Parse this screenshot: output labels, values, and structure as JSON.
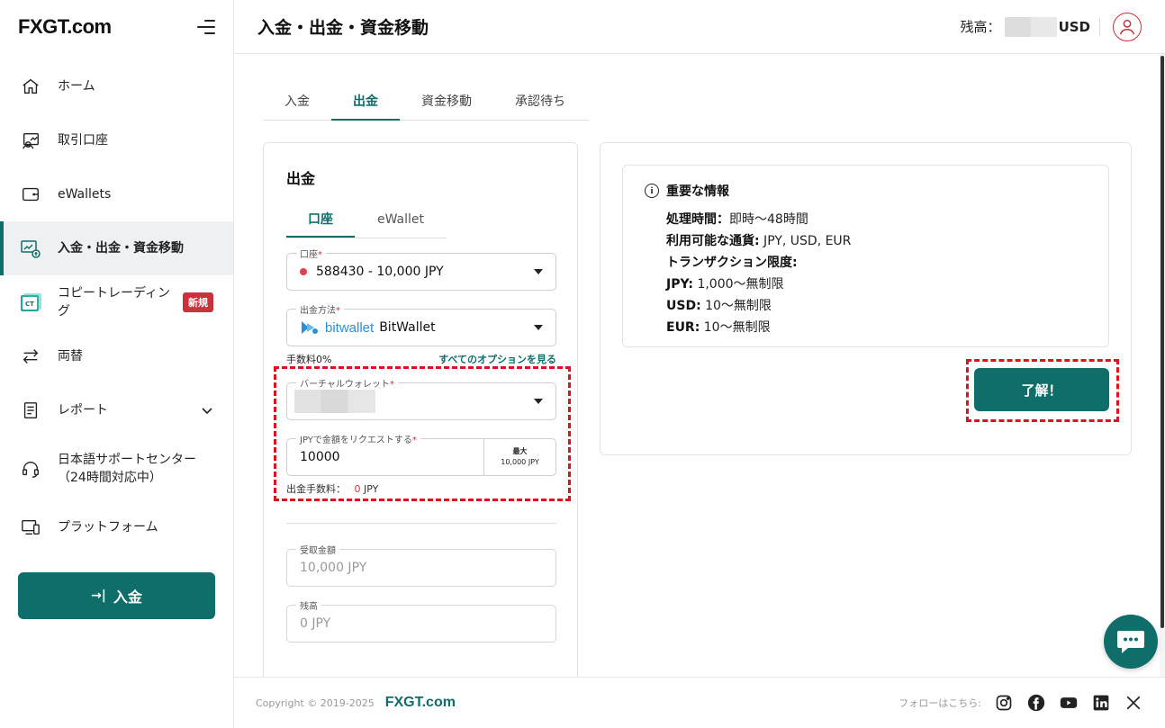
{
  "brand": {
    "logo": "FXGT.com",
    "accent": "#0f6e6a",
    "alert": "#c8323c"
  },
  "sidebar": {
    "items": [
      {
        "label": "ホーム",
        "icon": "home-icon"
      },
      {
        "label": "取引口座",
        "icon": "trading-account-icon"
      },
      {
        "label": "eWallets",
        "icon": "wallet-icon"
      },
      {
        "label": "入金・出金・資金移動",
        "icon": "funds-transfer-icon",
        "active": true
      },
      {
        "label": "コピートレーディング",
        "icon": "copy-trading-icon",
        "badge": "新規"
      },
      {
        "label": "両替",
        "icon": "exchange-icon"
      },
      {
        "label": "レポート",
        "icon": "report-icon"
      },
      {
        "label": "日本語サポートセンター（24時間対応中）",
        "icon": "support-headset-icon"
      },
      {
        "label": "プラットフォーム",
        "icon": "platform-icon"
      }
    ],
    "deposit_button": "入金"
  },
  "header": {
    "title": "入金・出金・資金移動",
    "balance_label": "残高：",
    "balance_currency": "USD"
  },
  "main": {
    "tabs": [
      "入金",
      "出金",
      "資金移動",
      "承認待ち"
    ],
    "active_tab": "出金",
    "withdraw": {
      "title": "出金",
      "subtabs": [
        "口座",
        "eWallet"
      ],
      "account": {
        "label": "口座",
        "value": "588430 - 10,000 JPY"
      },
      "method": {
        "label": "出金方法",
        "brand": "bitwallet",
        "value": "BitWallet"
      },
      "fee_text": "手数料0%",
      "see_all_options": "すべてのオプションを見る",
      "virtual_wallet": {
        "label": "バーチャルウォレット"
      },
      "amount": {
        "label": "JPYで金額をリクエストする",
        "value": "10000",
        "max_label": "最大",
        "max_value": "10,000 JPY"
      },
      "withdraw_fee": {
        "label": "出金手数料：",
        "value": "0",
        "unit": "JPY"
      },
      "received": {
        "label": "受取金額",
        "value": "10,000 JPY"
      },
      "remaining": {
        "label": "残高",
        "value": "0 JPY"
      },
      "required_mark": "*"
    },
    "info": {
      "title": "重要な情報",
      "lines": [
        {
          "key": "処理時間：",
          "value": "即時〜48時間"
        },
        {
          "key": "利用可能な通貨:",
          "value": " JPY, USD, EUR"
        },
        {
          "key": "トランザクション限度:",
          "value": ""
        },
        {
          "key": "JPY:",
          "value": " 1,000〜無制限"
        },
        {
          "key": "USD:",
          "value": " 10〜無制限"
        },
        {
          "key": "EUR:",
          "value": " 10〜無制限"
        }
      ],
      "ok_button": "了解！"
    }
  },
  "footer": {
    "copyright": "Copyright © 2019-2025",
    "logo": "FXGT.com",
    "follow": "フォローはこちら:",
    "social": [
      "instagram-icon",
      "facebook-icon",
      "youtube-icon",
      "linkedin-icon",
      "x-icon"
    ]
  }
}
